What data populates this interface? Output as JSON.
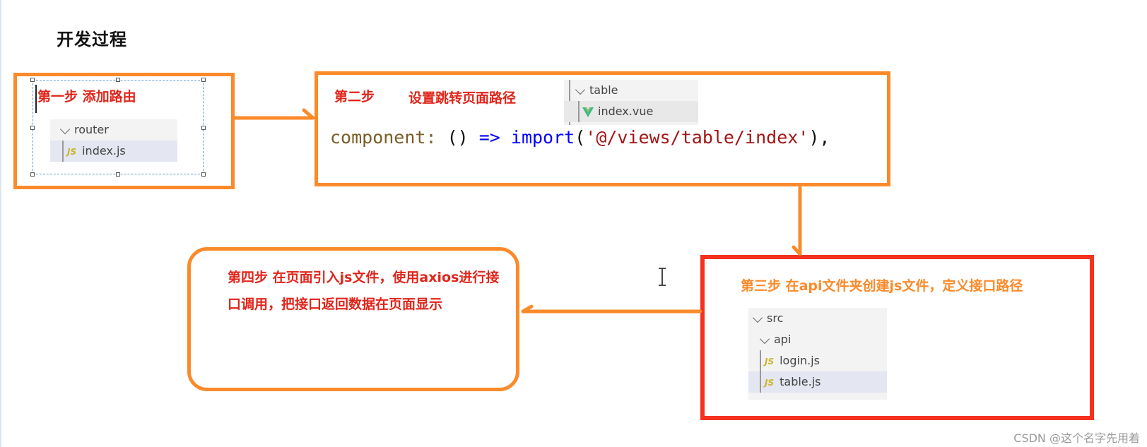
{
  "title": "开发过程",
  "colors": {
    "orange": "#fb8a2a",
    "red": "#f5311f",
    "label_red": "#e0251b"
  },
  "step1": {
    "label": "第一步 添加路由",
    "tree": [
      {
        "type": "folder",
        "name": "router"
      },
      {
        "type": "js",
        "icon": "JS",
        "name": "index.js",
        "selected": true
      }
    ]
  },
  "step2": {
    "label_a": "第二步",
    "label_b": "设置跳转页面路径",
    "tree": [
      {
        "type": "folder",
        "name": "table"
      },
      {
        "type": "vue",
        "name": "index.vue",
        "selected": true
      }
    ],
    "code": {
      "key": "component:",
      "parens": " () ",
      "arrow": "=>",
      "import_kw": " import",
      "open": "(",
      "path": "'@/views/table/index'",
      "close": "),"
    }
  },
  "step3": {
    "label": "第三步 在api文件夹创建js文件，定义接口路径",
    "tree": [
      {
        "type": "folder",
        "name": "src"
      },
      {
        "type": "folder",
        "name": "api"
      },
      {
        "type": "js",
        "icon": "JS",
        "name": "login.js"
      },
      {
        "type": "js",
        "icon": "JS",
        "name": "table.js",
        "selected": true
      }
    ]
  },
  "step4": {
    "label": "第四步 在页面引入js文件，使用axios进行接口调用，把接口返回数据在页面显示"
  },
  "watermark": "CSDN @这个名字先用着"
}
